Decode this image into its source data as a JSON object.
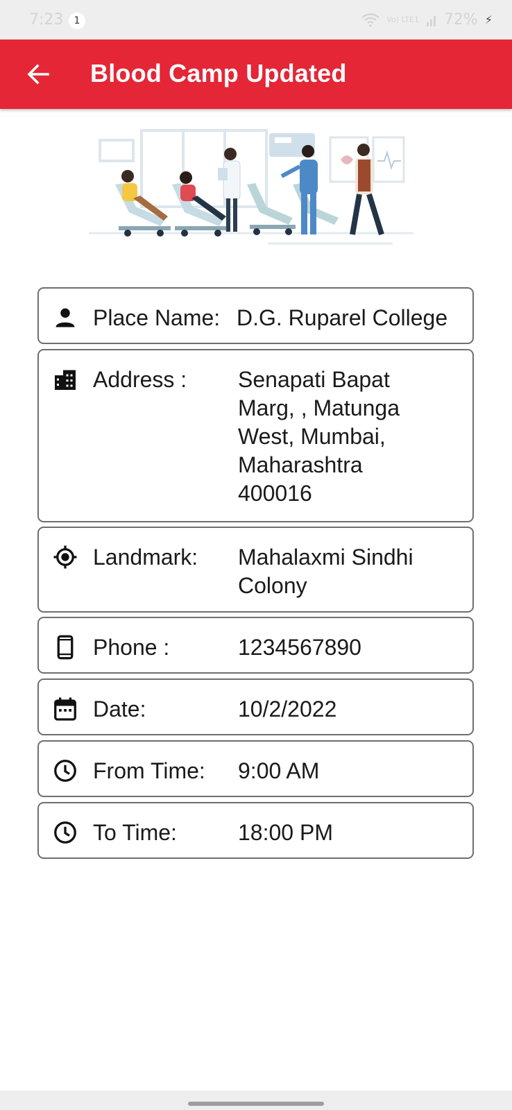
{
  "status_bar": {
    "time": "7:23",
    "notification_count": "1",
    "network": "Vo) LTE1",
    "battery": "72%"
  },
  "app_bar": {
    "title": "Blood Camp Updated",
    "color": "#e42636",
    "back_icon": "arrow-back-icon"
  },
  "details": {
    "place_name": {
      "label": "Place Name:",
      "value": "D.G. Ruparel College",
      "icon": "person-icon"
    },
    "address": {
      "label": "Address :",
      "value": "Senapati Bapat Marg, , Matunga West, Mumbai, Maharashtra 400016",
      "icon": "building-icon"
    },
    "landmark": {
      "label": "Landmark:",
      "value": "Mahalaxmi Sindhi Colony",
      "icon": "location-target-icon"
    },
    "phone": {
      "label": "Phone :",
      "value": "1234567890",
      "icon": "smartphone-icon"
    },
    "date": {
      "label": "Date:",
      "value": "10/2/2022",
      "icon": "calendar-icon"
    },
    "from_time": {
      "label": "From Time:",
      "value": "9:00 AM",
      "icon": "clock-icon"
    },
    "to_time": {
      "label": "To Time:",
      "value": "18:00 PM",
      "icon": "clock-icon"
    }
  },
  "colors": {
    "accent": "#e42636",
    "card_border": "#6e6e6e"
  }
}
